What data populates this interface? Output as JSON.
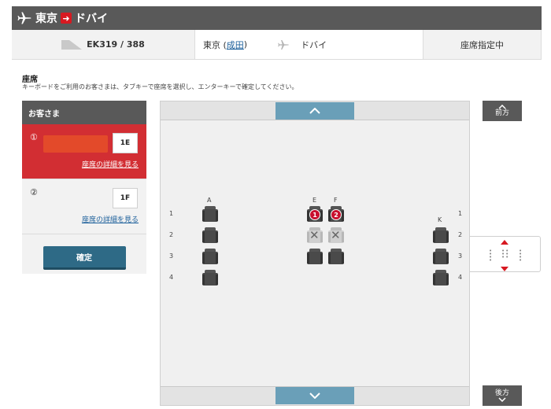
{
  "route": {
    "origin": "東京",
    "destination": "ドバイ"
  },
  "flight": {
    "number": "EK319 / 388",
    "origin_city": "東京 (",
    "origin_airport": "成田",
    "origin_close": ")",
    "destination": "ドバイ",
    "status": "座席指定中"
  },
  "section": {
    "title": "座席",
    "instructions": "キーボードをご利用のお客さまは、タブキーで座席を選択し、エンターキーで確定してください。"
  },
  "passengers_panel": {
    "title": "お客さま",
    "passengers": [
      {
        "number": "①",
        "seat": "1E",
        "detail_link": "座席の詳細を見る"
      },
      {
        "number": "②",
        "seat": "1F",
        "detail_link": "座席の詳細を見る"
      }
    ],
    "confirm_label": "確定"
  },
  "cabin": {
    "columns": [
      "A",
      "E",
      "F",
      "K"
    ],
    "rows_left": [
      "1",
      "2",
      "3",
      "4"
    ],
    "rows_right": [
      "1",
      "2",
      "3",
      "4"
    ],
    "assigned_badges": [
      "1",
      "2"
    ]
  },
  "nav": {
    "forward": "前方",
    "aft": "後方"
  },
  "colors": {
    "accent": "#d71921",
    "selected_panel": "#d22e33",
    "confirm": "#2e6a86",
    "header": "#595959"
  }
}
